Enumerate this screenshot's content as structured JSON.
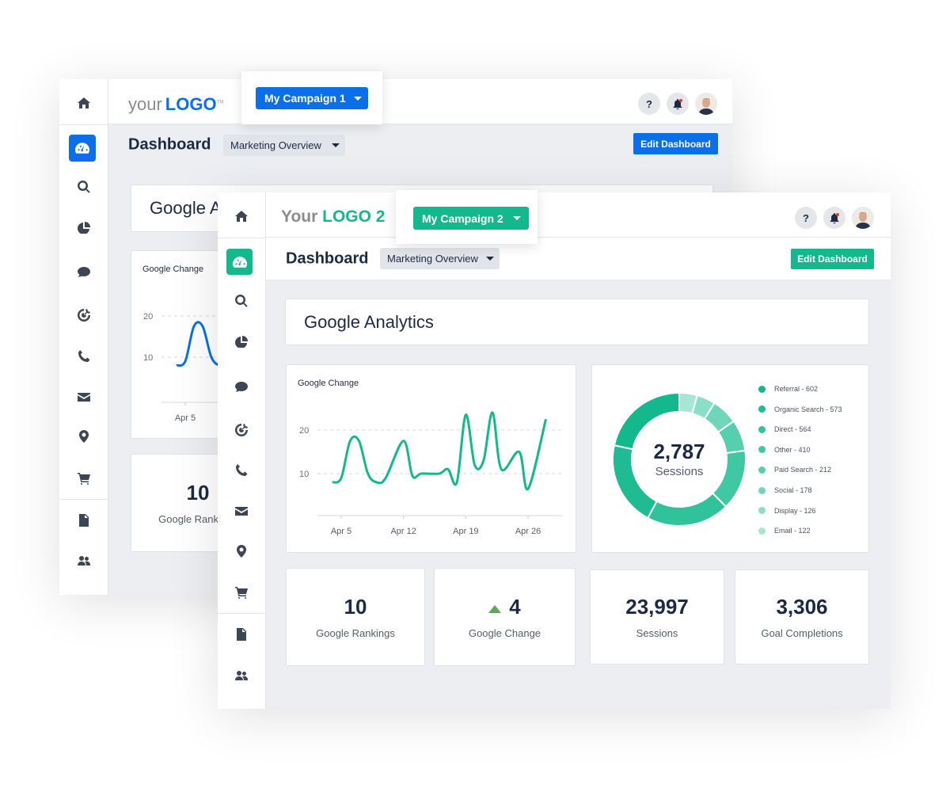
{
  "back_window": {
    "logo": {
      "prefix": "your",
      "brand": "LOGO",
      "tm": "TM"
    },
    "campaign_button": "My Campaign 1",
    "help_label": "?",
    "page_title": "Dashboard",
    "dashboard_select": "Marketing Overview",
    "edit_button": "Edit Dashboard",
    "section_title": "Google Analytics",
    "chart_title": "Google Change",
    "chart_yticks": [
      "20",
      "10"
    ],
    "chart_xtick": "Apr 5",
    "kpi": {
      "value": "10",
      "label": "Google Rankings"
    },
    "accent": "#0a6fe8"
  },
  "front_window": {
    "logo": {
      "prefix": "Your",
      "brand": "LOGO 2"
    },
    "campaign_button": "My Campaign 2",
    "help_label": "?",
    "page_title": "Dashboard",
    "dashboard_select": "Marketing Overview",
    "edit_button": "Edit Dashboard",
    "section_title": "Google Analytics",
    "accent": "#13b88c",
    "kpis": [
      {
        "value": "10",
        "label": "Google Rankings"
      },
      {
        "value": "4",
        "label": "Google Change",
        "trend": "up"
      },
      {
        "value": "23,997",
        "label": "Sessions"
      },
      {
        "value": "3,306",
        "label": "Goal Completions"
      }
    ]
  },
  "sidebar_icons": [
    "home-icon",
    "dashboard-icon",
    "search-icon",
    "pie-chart-icon",
    "chat-icon",
    "target-icon",
    "phone-icon",
    "mail-icon",
    "map-pin-icon",
    "cart-icon",
    "document-icon",
    "users-icon"
  ],
  "chart_data": [
    {
      "type": "line",
      "title": "Google Change",
      "xlabel": "",
      "ylabel": "",
      "x": [
        "Apr 4",
        "Apr 5",
        "Apr 6",
        "Apr 7",
        "Apr 8",
        "Apr 9",
        "Apr 10",
        "Apr 12",
        "Apr 13",
        "Apr 14",
        "Apr 16",
        "Apr 17",
        "Apr 18",
        "Apr 19",
        "Apr 20",
        "Apr 21",
        "Apr 22",
        "Apr 23",
        "Apr 25",
        "Apr 26",
        "Apr 28"
      ],
      "values": [
        8,
        9,
        17.5,
        17.5,
        10,
        8,
        9,
        17.5,
        9.5,
        10,
        10,
        11,
        8,
        23.5,
        12,
        13,
        24,
        11,
        15,
        6.5,
        22.5
      ],
      "yticks": [
        10,
        20
      ],
      "xticks": [
        "Apr 5",
        "Apr 12",
        "Apr 19",
        "Apr 26"
      ],
      "grid": "dashed horizontal",
      "color": "#13b88c"
    },
    {
      "type": "pie",
      "donut": true,
      "center_value": "2,787",
      "center_label": "Sessions",
      "legend_position": "right",
      "slices": [
        {
          "label": "Referral - 602",
          "value": 602,
          "color": "#13b88c"
        },
        {
          "label": "Organic Search - 573",
          "value": 573,
          "color": "#20bb93"
        },
        {
          "label": "Direct - 564",
          "value": 564,
          "color": "#2fc29b"
        },
        {
          "label": "Other - 410",
          "value": 410,
          "color": "#3fc8a3"
        },
        {
          "label": "Paid Search - 212",
          "value": 212,
          "color": "#55cfae"
        },
        {
          "label": "Social - 178",
          "value": 178,
          "color": "#6fd6ba"
        },
        {
          "label": "Display - 126",
          "value": 126,
          "color": "#8adfc8"
        },
        {
          "label": "Email - 122",
          "value": 122,
          "color": "#a5e6d5"
        }
      ]
    }
  ]
}
